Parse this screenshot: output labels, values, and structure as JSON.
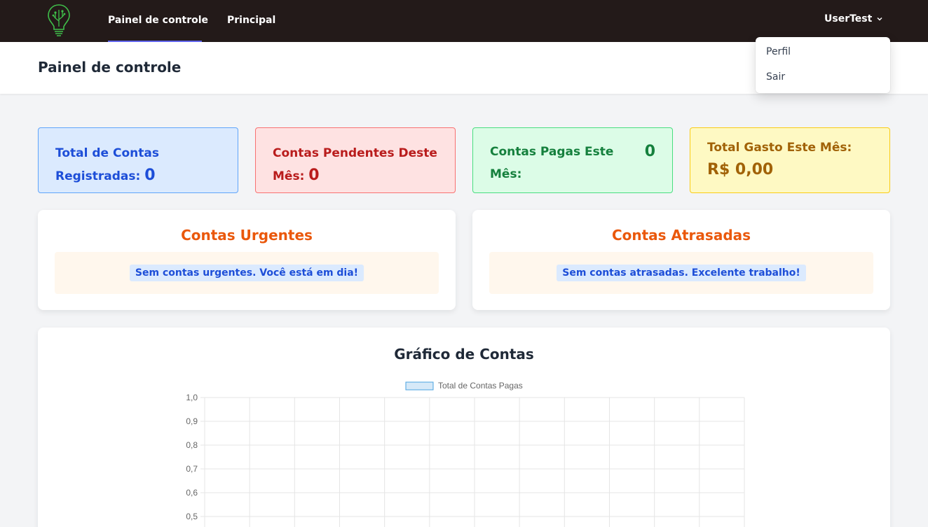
{
  "nav": {
    "items": [
      {
        "label": "Painel de controle",
        "active": true
      },
      {
        "label": "Principal",
        "active": false
      }
    ],
    "user": "UserTest"
  },
  "user_dropdown": {
    "items": [
      "Perfil",
      "Sair"
    ]
  },
  "header": {
    "title": "Painel de controle"
  },
  "stats": {
    "total_label": "Total de Contas Registradas:",
    "total_value": "0",
    "pending_label": "Contas Pendentes Deste Mês:",
    "pending_value": "0",
    "paid_label": "Contas Pagas Este Mês:",
    "paid_value": "0",
    "spent_label": "Total Gasto Este Mês:",
    "spent_value": "R$ 0,00"
  },
  "urgent": {
    "title": "Contas Urgentes",
    "message": "Sem contas urgentes. Você está em dia!"
  },
  "overdue": {
    "title": "Contas Atrasadas",
    "message": "Sem contas atrasadas. Excelente trabalho!"
  },
  "chart_section": {
    "title": "Gráfico de Contas"
  },
  "colors": {
    "nav_bg": "#231a19",
    "active_underline": "#6366f1",
    "urgent_title": "#ea580c",
    "series_fill": "#d6e9f8",
    "series_border": "#4aa3e0"
  },
  "chart_data": {
    "type": "bar",
    "series": [
      {
        "name": "Total de Contas Pagas",
        "values": []
      }
    ],
    "categories": [],
    "ylim": [
      0,
      1
    ],
    "y_ticks": [
      "1,0",
      "0,9",
      "0,8",
      "0,7",
      "0,6",
      "0,5"
    ],
    "grid": true,
    "legend": "top"
  }
}
